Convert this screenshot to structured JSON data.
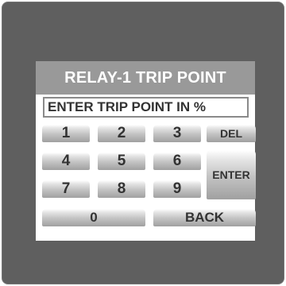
{
  "screen": {
    "title": "RELAY-1 TRIP POINT",
    "prompt": "ENTER TRIP POINT IN %"
  },
  "keypad": {
    "k1": "1",
    "k2": "2",
    "k3": "3",
    "k4": "4",
    "k5": "5",
    "k6": "6",
    "k7": "7",
    "k8": "8",
    "k9": "9",
    "k0": "0",
    "del": "DEL",
    "enter": "ENTER",
    "back": "BACK"
  },
  "colors": {
    "bezel": "#5f5f5f",
    "title_bar": "#999999",
    "key_text": "#333333"
  }
}
